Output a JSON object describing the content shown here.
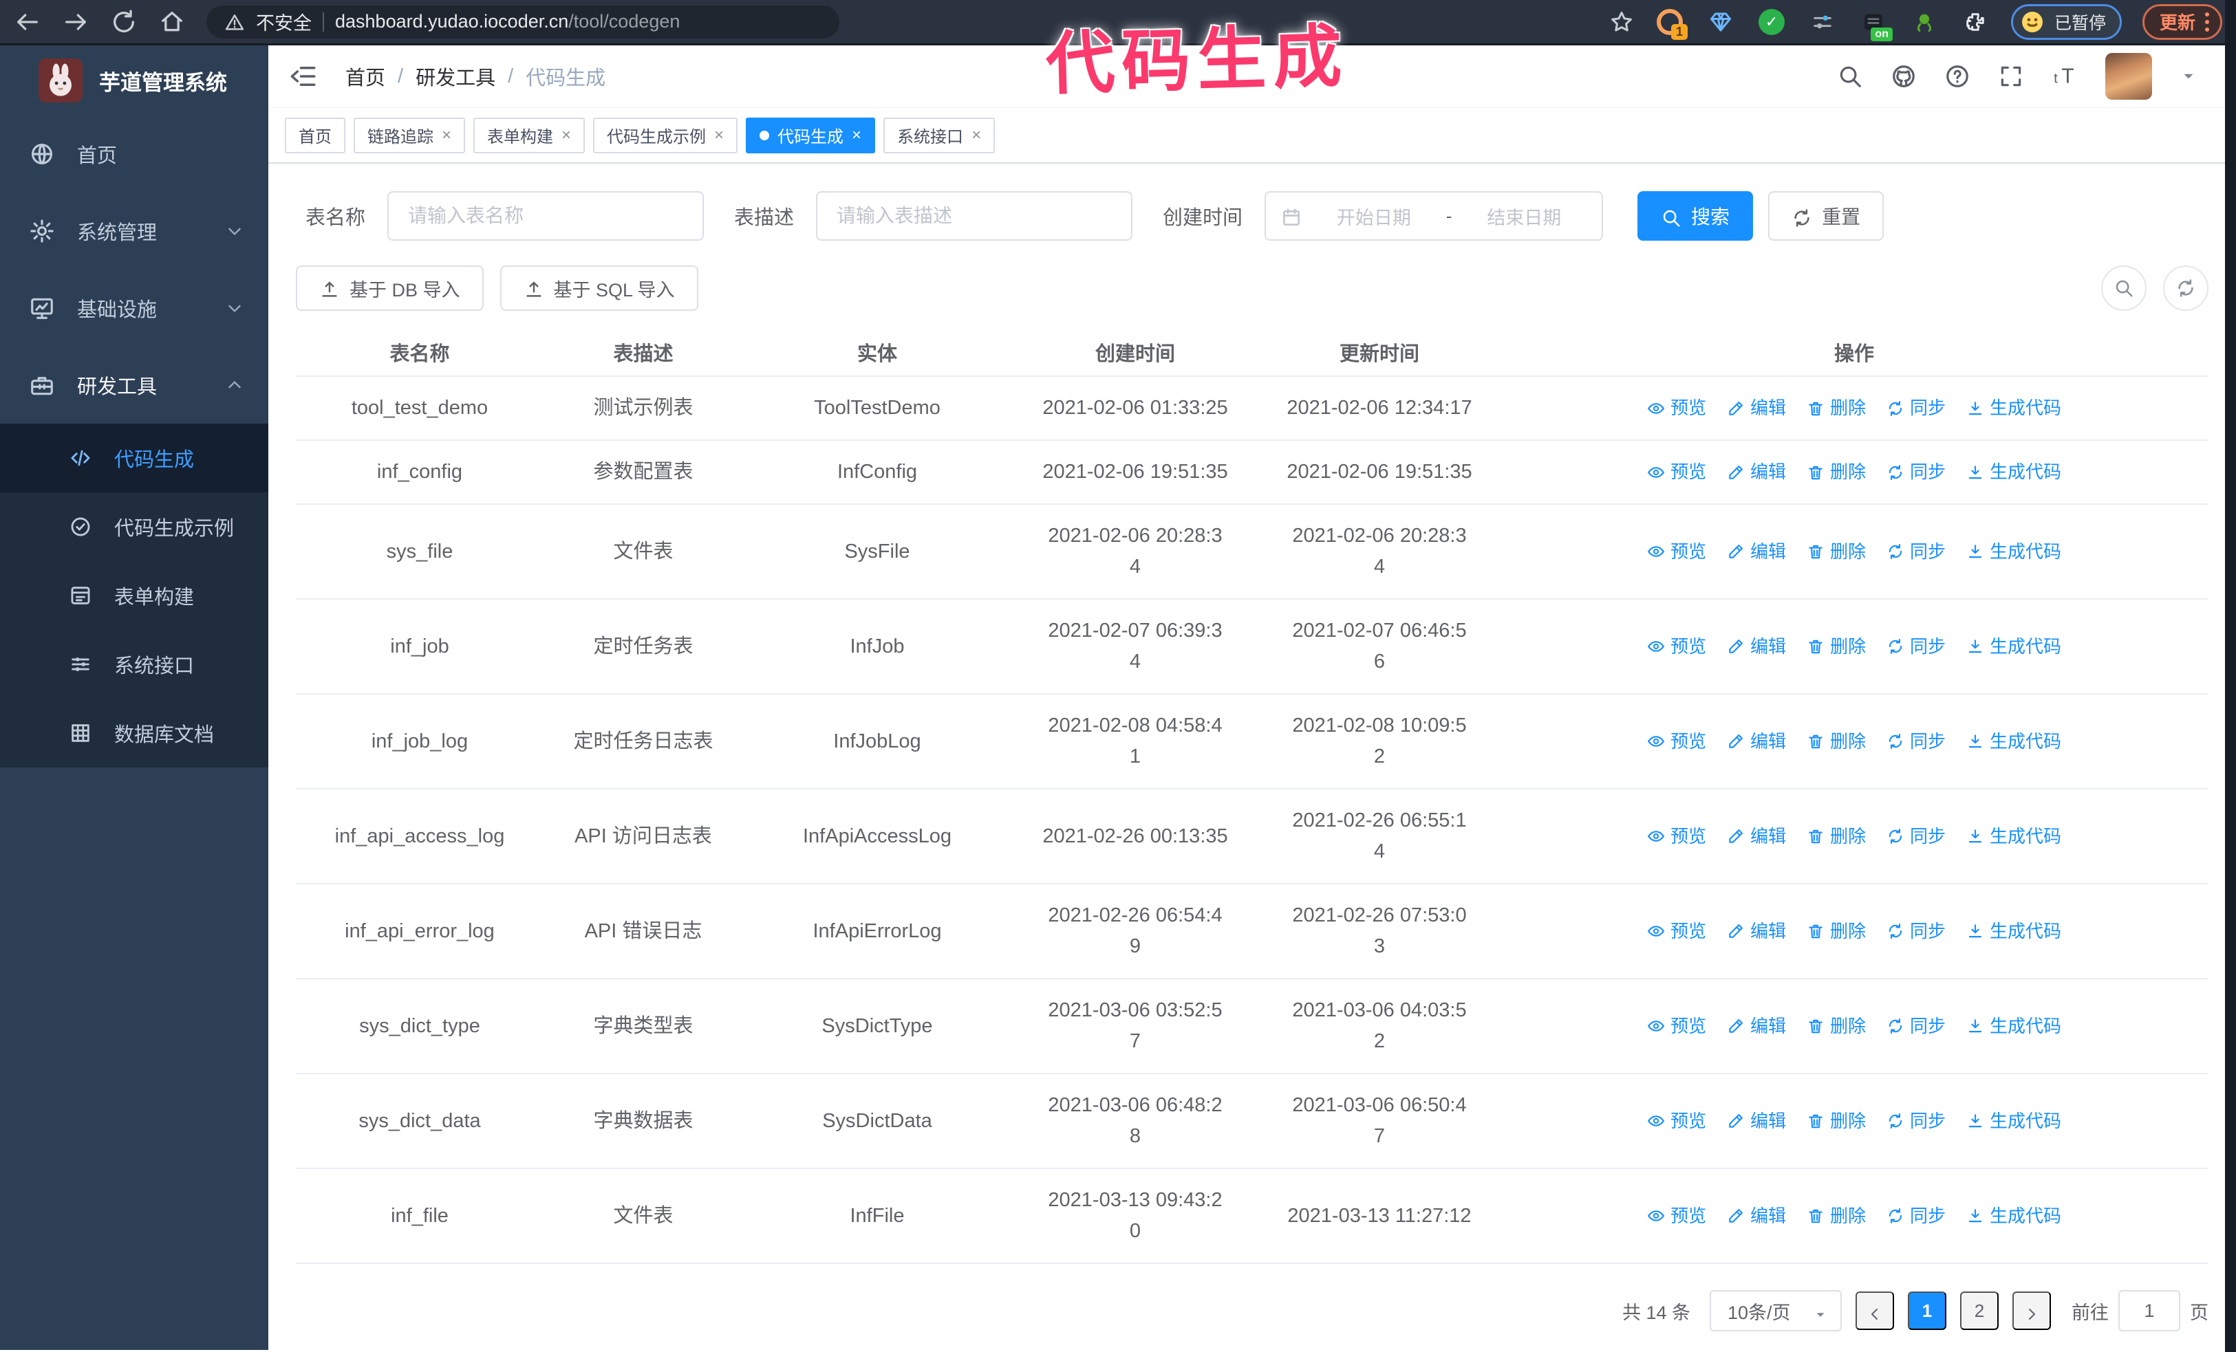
{
  "browser": {
    "security_label": "不安全",
    "url_domain": "dashboard.yudao.iocoder.cn",
    "url_path": "/tool/codegen",
    "profile_badge": "已暂停",
    "update_button": "更新",
    "ext_badge_count": "1",
    "ext_badge_on": "on"
  },
  "annotation": {
    "text": "代码生成",
    "color": "#fa3a6d"
  },
  "sidebar": {
    "logo_title": "芋道管理系统",
    "menu": [
      {
        "label": "首页",
        "icon": "globe",
        "expandable": false,
        "state": "none"
      },
      {
        "label": "系统管理",
        "icon": "gear",
        "expandable": true,
        "state": "collapsed"
      },
      {
        "label": "基础设施",
        "icon": "monitor",
        "expandable": true,
        "state": "collapsed"
      },
      {
        "label": "研发工具",
        "icon": "toolbox",
        "expandable": true,
        "state": "expanded"
      }
    ],
    "submenu": [
      {
        "label": "代码生成",
        "icon": "code",
        "active": true
      },
      {
        "label": "代码生成示例",
        "icon": "badgeCheck",
        "active": false
      },
      {
        "label": "表单构建",
        "icon": "form",
        "active": false
      },
      {
        "label": "系统接口",
        "icon": "sliders",
        "active": false
      },
      {
        "label": "数据库文档",
        "icon": "dbGrid",
        "active": false
      }
    ]
  },
  "header": {
    "breadcrumb": [
      "首页",
      "研发工具",
      "代码生成"
    ],
    "breadcrumb_separator": "/"
  },
  "tabs": [
    {
      "label": "首页",
      "closable": false,
      "active": false
    },
    {
      "label": "链路追踪",
      "closable": true,
      "active": false
    },
    {
      "label": "表单构建",
      "closable": true,
      "active": false
    },
    {
      "label": "代码生成示例",
      "closable": true,
      "active": false
    },
    {
      "label": "代码生成",
      "closable": true,
      "active": true
    },
    {
      "label": "系统接口",
      "closable": true,
      "active": false
    }
  ],
  "tab_close_glyph": "×",
  "filters": {
    "table_name_label": "表名称",
    "table_name_placeholder": "请输入表名称",
    "table_desc_label": "表描述",
    "table_desc_placeholder": "请输入表描述",
    "create_time_label": "创建时间",
    "date_start_placeholder": "开始日期",
    "date_separator": "-",
    "date_end_placeholder": "结束日期",
    "search_label": "搜索",
    "reset_label": "重置"
  },
  "toolbar": {
    "import_db_label": "基于 DB 导入",
    "import_sql_label": "基于 SQL 导入"
  },
  "table": {
    "columns": [
      "表名称",
      "表描述",
      "实体",
      "创建时间",
      "更新时间",
      "操作"
    ],
    "actions": [
      {
        "label": "预览",
        "icon": "eye"
      },
      {
        "label": "编辑",
        "icon": "edit"
      },
      {
        "label": "删除",
        "icon": "trash"
      },
      {
        "label": "同步",
        "icon": "sync"
      },
      {
        "label": "生成代码",
        "icon": "download"
      }
    ],
    "rows": [
      {
        "name": "tool_test_demo",
        "desc": "测试示例表",
        "entity": "ToolTestDemo",
        "create_time": [
          "2021-02-06 01:33:25"
        ],
        "update_time": [
          "2021-02-06 12:34:17"
        ]
      },
      {
        "name": "inf_config",
        "desc": "参数配置表",
        "entity": "InfConfig",
        "create_time": [
          "2021-02-06 19:51:35"
        ],
        "update_time": [
          "2021-02-06 19:51:35"
        ]
      },
      {
        "name": "sys_file",
        "desc": "文件表",
        "entity": "SysFile",
        "create_time": [
          "2021-02-06 20:28:3",
          "4"
        ],
        "update_time": [
          "2021-02-06 20:28:3",
          "4"
        ]
      },
      {
        "name": "inf_job",
        "desc": "定时任务表",
        "entity": "InfJob",
        "create_time": [
          "2021-02-07 06:39:3",
          "4"
        ],
        "update_time": [
          "2021-02-07 06:46:5",
          "6"
        ]
      },
      {
        "name": "inf_job_log",
        "desc": "定时任务日志表",
        "entity": "InfJobLog",
        "create_time": [
          "2021-02-08 04:58:4",
          "1"
        ],
        "update_time": [
          "2021-02-08 10:09:5",
          "2"
        ]
      },
      {
        "name": "inf_api_access_log",
        "desc": "API 访问日志表",
        "entity": "InfApiAccessLog",
        "create_time": [
          "2021-02-26 00:13:35"
        ],
        "update_time": [
          "2021-02-26 06:55:1",
          "4"
        ]
      },
      {
        "name": "inf_api_error_log",
        "desc": "API 错误日志",
        "entity": "InfApiErrorLog",
        "create_time": [
          "2021-02-26 06:54:4",
          "9"
        ],
        "update_time": [
          "2021-02-26 07:53:0",
          "3"
        ]
      },
      {
        "name": "sys_dict_type",
        "desc": "字典类型表",
        "entity": "SysDictType",
        "create_time": [
          "2021-03-06 03:52:5",
          "7"
        ],
        "update_time": [
          "2021-03-06 04:03:5",
          "2"
        ]
      },
      {
        "name": "sys_dict_data",
        "desc": "字典数据表",
        "entity": "SysDictData",
        "create_time": [
          "2021-03-06 06:48:2",
          "8"
        ],
        "update_time": [
          "2021-03-06 06:50:4",
          "7"
        ]
      },
      {
        "name": "inf_file",
        "desc": "文件表",
        "entity": "InfFile",
        "create_time": [
          "2021-03-13 09:43:2",
          "0"
        ],
        "update_time": [
          "2021-03-13 11:27:12"
        ]
      }
    ]
  },
  "pagination": {
    "total_label": "共 14 条",
    "page_size": "10条/页",
    "pages": [
      "1",
      "2"
    ],
    "active_page": "1",
    "goto_label": "前往",
    "goto_value": "1",
    "page_suffix": "页"
  },
  "colors": {
    "accent": "#1890ff",
    "menu_active": "#409eff",
    "annotation": "#fa3a6d"
  }
}
